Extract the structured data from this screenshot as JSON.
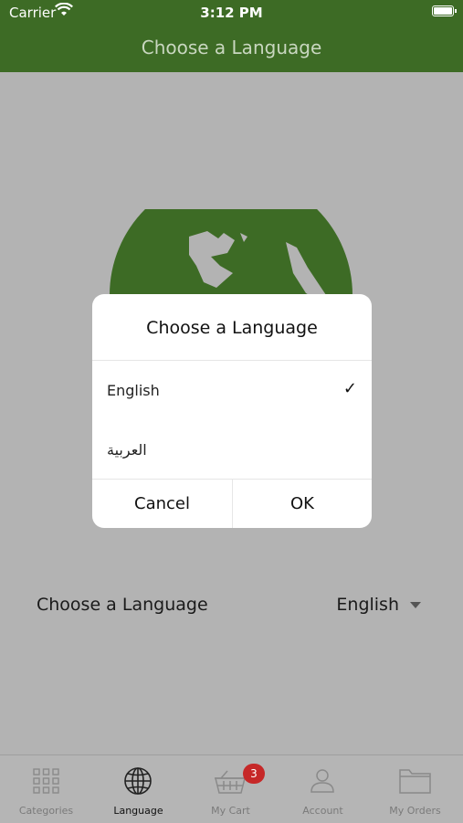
{
  "status": {
    "carrier": "Carrier",
    "time": "3:12 PM"
  },
  "header": {
    "title": "Choose a Language"
  },
  "main": {
    "language_label": "Choose a Language",
    "language_value": "English"
  },
  "dialog": {
    "title": "Choose a Language",
    "options": [
      {
        "label": "English",
        "selected": true
      },
      {
        "label": "العربية",
        "selected": false
      }
    ],
    "check_glyph": "✓",
    "cancel_label": "Cancel",
    "ok_label": "OK"
  },
  "tabbar": {
    "items": [
      {
        "label": "Categories",
        "icon": "grid-icon",
        "active": false
      },
      {
        "label": "Language",
        "icon": "globe-icon",
        "active": true
      },
      {
        "label": "My Cart",
        "icon": "basket-icon",
        "active": false
      },
      {
        "label": "Account",
        "icon": "user-icon",
        "active": false
      },
      {
        "label": "My Orders",
        "icon": "folder-icon",
        "active": false
      }
    ],
    "cart_badge": "3"
  },
  "colors": {
    "brand_green": "#3d6b25",
    "overlay_gray": "#b3b3b3",
    "badge_red": "#c62828"
  }
}
